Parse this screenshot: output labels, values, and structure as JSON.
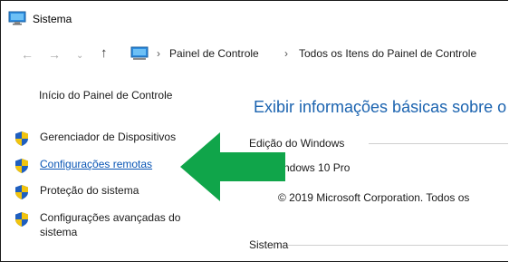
{
  "window": {
    "title": "Sistema"
  },
  "address_bar": {
    "breadcrumbs": [
      "Painel de Controle",
      "Todos os Itens do Painel de Controle"
    ],
    "separator": "›"
  },
  "sidebar": {
    "home_label": "Início do Painel de Controle",
    "items": [
      {
        "label": "Gerenciador de Dispositivos",
        "icon": "shield-icon"
      },
      {
        "label": "Configurações remotas",
        "icon": "shield-icon",
        "highlighted": true
      },
      {
        "label": "Proteção do sistema",
        "icon": "shield-icon"
      },
      {
        "label": "Configurações avançadas do",
        "label2": "sistema",
        "icon": "shield-icon"
      }
    ]
  },
  "main": {
    "title": "Exibir informações básicas sobre o",
    "edition_heading": "Edição do Windows",
    "edition_value": "ndows 10 Pro",
    "copyright": "© 2019 Microsoft Corporation. Todos os",
    "system_heading": "Sistema"
  },
  "annotation": {
    "icon": "green-arrow-icon",
    "color": "#10a54a"
  },
  "colors": {
    "link": "#0a56b5",
    "title": "#1c64b0"
  }
}
